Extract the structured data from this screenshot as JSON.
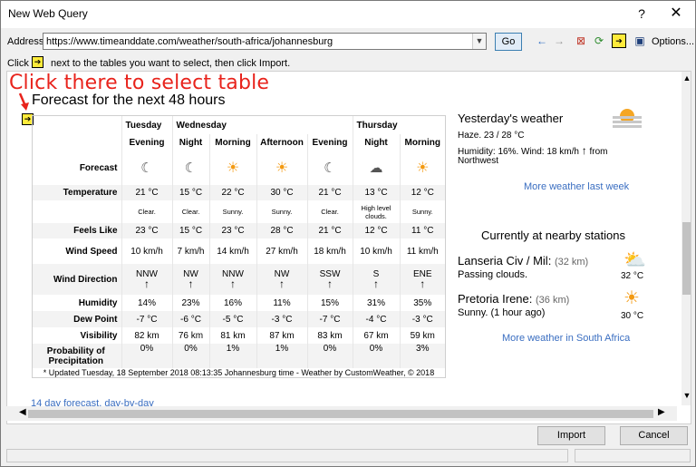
{
  "window": {
    "title": "New Web Query",
    "help": "?",
    "close": "✕"
  },
  "address": {
    "label": "Address:",
    "url": "https://www.timeanddate.com/weather/south-africa/johannesburg",
    "go_label": "Go",
    "options_label": "Options..."
  },
  "hint": {
    "prefix": "Click",
    "suffix": "next to the tables you want to select, then click Import."
  },
  "annotation": {
    "text": "Click there to select table",
    "color": "#e8231c"
  },
  "forecast": {
    "title": "Forecast for the next 48 hours",
    "days": [
      "Tuesday",
      "Wednesday",
      "Thursday"
    ],
    "periods": [
      "Evening",
      "Night",
      "Morning",
      "Afternoon",
      "Evening",
      "Night",
      "Morning"
    ],
    "row_labels": {
      "forecast": "Forecast",
      "temperature": "Temperature",
      "feels_like": "Feels Like",
      "wind_speed": "Wind Speed",
      "wind_direction": "Wind Direction",
      "humidity": "Humidity",
      "dew_point": "Dew Point",
      "visibility": "Visibility",
      "precip": "Probability of Precipitation"
    },
    "icons": [
      "moon-cloud",
      "moon-cloud",
      "sun",
      "sun",
      "moon-cloud",
      "night-cloud",
      "sun"
    ],
    "temperature": [
      "21 °C",
      "15 °C",
      "22 °C",
      "30 °C",
      "21 °C",
      "13 °C",
      "12 °C"
    ],
    "conditions": [
      "Clear.",
      "Clear.",
      "Sunny.",
      "Sunny.",
      "Clear.",
      "High level clouds.",
      "Sunny."
    ],
    "feels_like": [
      "23 °C",
      "15 °C",
      "23 °C",
      "28 °C",
      "21 °C",
      "12 °C",
      "11 °C"
    ],
    "wind_speed": [
      "10 km/h",
      "7 km/h",
      "14 km/h",
      "27 km/h",
      "18 km/h",
      "10 km/h",
      "11 km/h"
    ],
    "wind_direction": [
      "NNW",
      "NW",
      "NNW",
      "NW",
      "SSW",
      "S",
      "ENE"
    ],
    "humidity": [
      "14%",
      "23%",
      "16%",
      "11%",
      "15%",
      "31%",
      "35%"
    ],
    "dew_point": [
      "-7 °C",
      "-6 °C",
      "-5 °C",
      "-3 °C",
      "-7 °C",
      "-4 °C",
      "-3 °C"
    ],
    "visibility": [
      "82 km",
      "76 km",
      "81 km",
      "87 km",
      "83 km",
      "67 km",
      "59 km"
    ],
    "precip": [
      "0%",
      "0%",
      "1%",
      "1%",
      "0%",
      "0%",
      "3%"
    ],
    "updated": "* Updated Tuesday, 18 September 2018 08:13:35 Johannesburg time - Weather by CustomWeather, © 2018",
    "link": "14 day forecast, day-by-day"
  },
  "yesterday": {
    "title": "Yesterday's weather",
    "line1": "Haze. 23 / 28 °C",
    "line2": "Humidity: 16%. Wind: 18 km/h",
    "line2b": "from",
    "line3": "Northwest",
    "link": "More weather last week"
  },
  "nearby": {
    "title": "Currently at nearby stations",
    "stations": [
      {
        "name": "Lanseria Civ / Mil:",
        "dist": "(32 km)",
        "desc": "Passing clouds.",
        "temp": "32 °C"
      },
      {
        "name": "Pretoria Irene:",
        "dist": "(36 km)",
        "desc": "Sunny. (1 hour ago)",
        "temp": "30 °C"
      }
    ],
    "link": "More weather in South Africa"
  },
  "buttons": {
    "import": "Import",
    "cancel": "Cancel"
  }
}
